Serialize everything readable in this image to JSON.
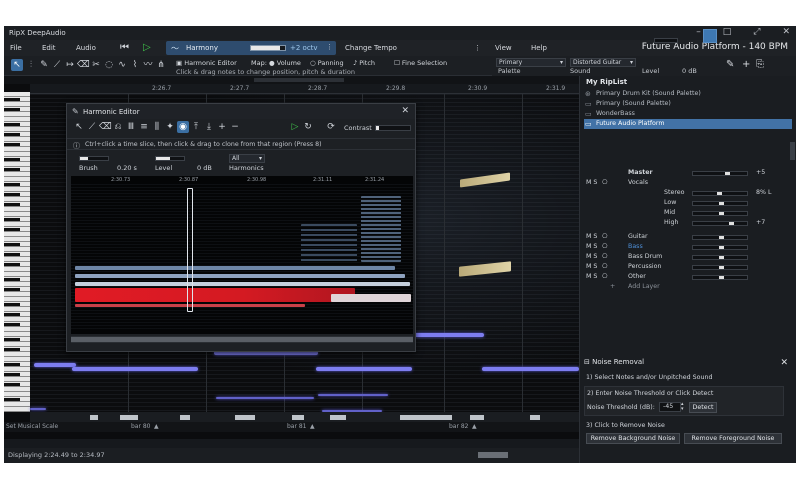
{
  "app": {
    "title": "RipX DeepAudio",
    "platform": "Future Audio Platform - 140 BPM"
  },
  "menu": {
    "file": "File",
    "edit": "Edit",
    "audio": "Audio",
    "change_tempo": "Change Tempo",
    "view": "View",
    "help": "Help"
  },
  "harmony": {
    "label": "Harmony",
    "octave": "+2 octv",
    "level": 0.85
  },
  "toolbar": {
    "harmonic_editor": "Harmonic Editor",
    "map": "Map:",
    "volume": "Volume",
    "panning": "Panning",
    "pitch": "Pitch",
    "fine_selection": "Fine Selection",
    "hint": "Click & drag notes to change position, pitch & duration"
  },
  "right_toolbar": {
    "palette_value": "Primary",
    "palette_label": "Palette",
    "sound_value": "Distorted Guitar",
    "sound_label": "Sound",
    "level_label": "Level",
    "level_value": "0 dB"
  },
  "ruler": [
    "2:26.7",
    "2:27.7",
    "2:28.7",
    "2:29.8",
    "2:30.9",
    "2:31.9"
  ],
  "bars": {
    "bar80": "bar 80",
    "bar81": "bar 81",
    "bar82": "bar 82"
  },
  "musical_scale": "Set Musical Scale",
  "status": "Displaying 2:24.49 to 2:34.97",
  "harmonic_editor": {
    "title": "Harmonic Editor",
    "contrast": "Contrast",
    "contrast_level": 0.1,
    "hint": "Ctrl+click a time slice, then click & drag to clone from that region (Press 8)",
    "brush_label": "Brush",
    "brush_value": "0.20 s",
    "level_label": "Level",
    "level_value": "0 dB",
    "harmonics_label": "Harmonics",
    "harmonics_value": "All",
    "times": [
      "2:30.73",
      "2:30.87",
      "2:30.98",
      "2:31.11",
      "2:31.24"
    ]
  },
  "riplist": {
    "title": "My RipList",
    "items": [
      "Primary Drum Kit (Sound Palette)",
      "Primary (Sound Palette)",
      "WonderBass",
      "Future Audio Platform"
    ]
  },
  "mixer": {
    "master": "Master",
    "master_value": "+5",
    "vocals": "Vocals",
    "stereo": "Stereo",
    "stereo_value": "8% L",
    "low": "Low",
    "mid": "Mid",
    "high": "High",
    "high_value": "+7",
    "guitar": "Guitar",
    "bass": "Bass",
    "bass_drum": "Bass Drum",
    "percussion": "Percussion",
    "other": "Other",
    "add_layer": "Add Layer",
    "ms": "M S"
  },
  "noise": {
    "title": "Noise Removal",
    "step1": "1) Select Notes and/or Unpitched Sound",
    "step2": "2) Enter Noise Threshold or Click Detect",
    "threshold_label": "Noise Threshold (dB):",
    "threshold_value": "-45",
    "detect": "Detect",
    "step3": "3) Click to Remove Noise",
    "remove_bg": "Remove Background Noise",
    "remove_fg": "Remove Foreground Noise"
  },
  "colors": {
    "accent": "#3b6fa3",
    "note": "#7d7df0",
    "spectral_red": "#e0202a",
    "selection": "#4272a6"
  }
}
